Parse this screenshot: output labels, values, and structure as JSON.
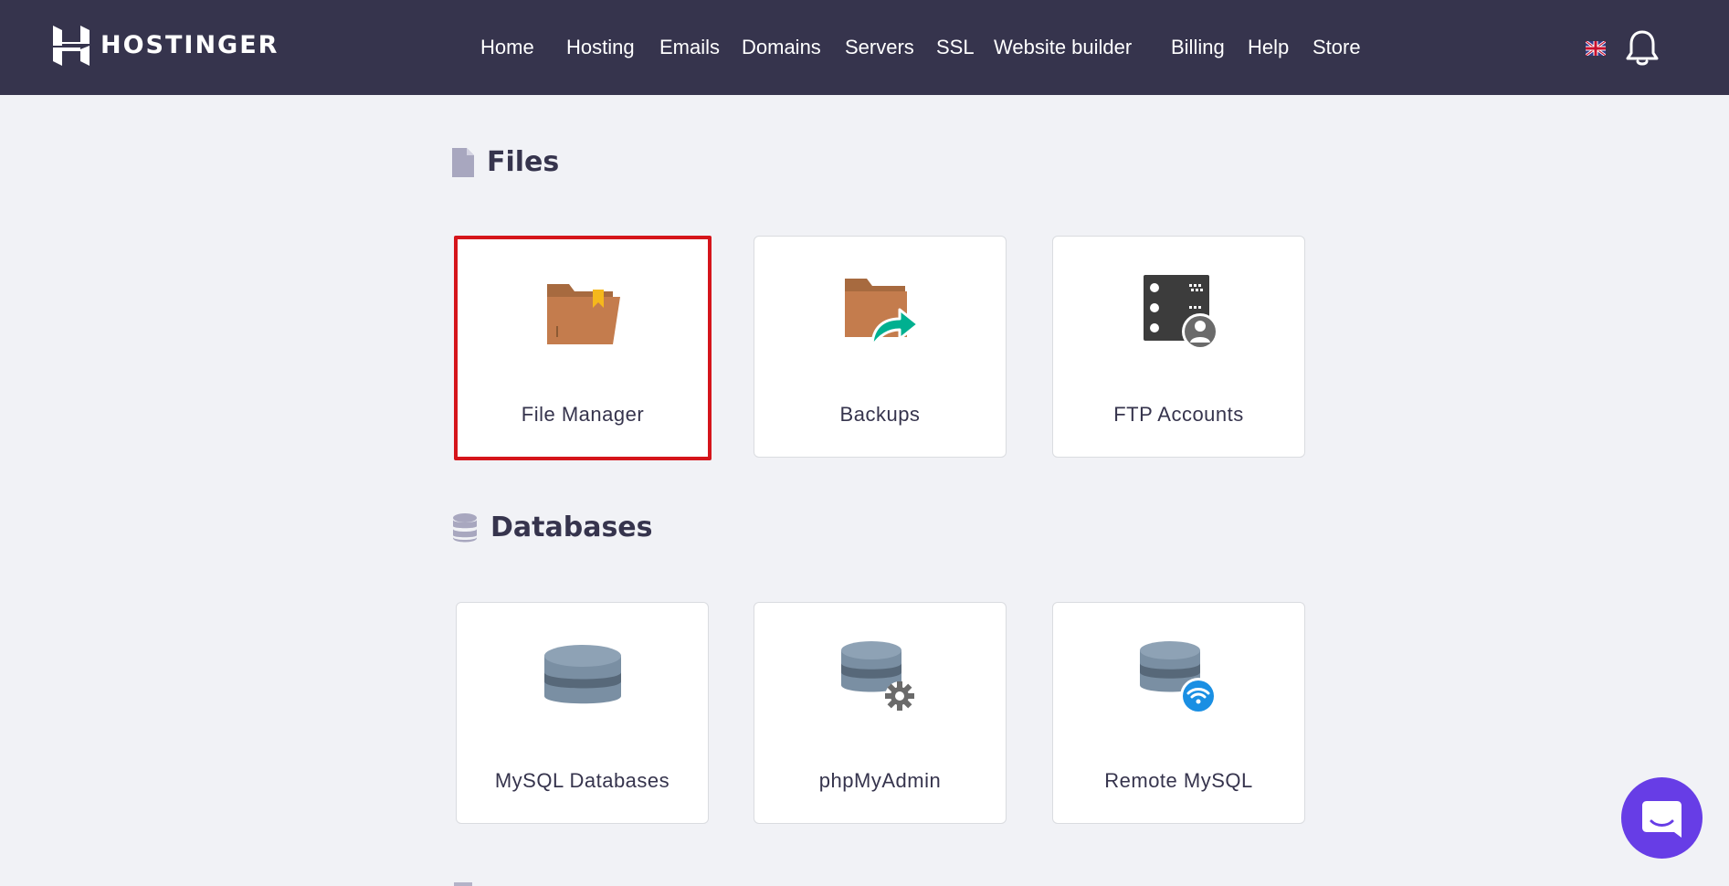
{
  "header": {
    "brand": "HOSTINGER",
    "nav": [
      {
        "label": "Home"
      },
      {
        "label": "Hosting"
      },
      {
        "label": "Emails"
      },
      {
        "label": "Domains"
      },
      {
        "label": "Servers"
      },
      {
        "label": "SSL"
      },
      {
        "label": "Website builder"
      },
      {
        "label": "Billing"
      },
      {
        "label": "Help"
      },
      {
        "label": "Store"
      }
    ],
    "language_icon": "uk-flag-icon",
    "notifications_icon": "bell-icon"
  },
  "sections": {
    "files": {
      "title": "Files",
      "icon": "file-icon",
      "cards": [
        {
          "label": "File Manager",
          "icon": "folder-icon",
          "highlighted": true
        },
        {
          "label": "Backups",
          "icon": "backup-folder-icon"
        },
        {
          "label": "FTP Accounts",
          "icon": "ftp-server-icon"
        }
      ]
    },
    "databases": {
      "title": "Databases",
      "icon": "database-icon",
      "cards": [
        {
          "label": "MySQL Databases",
          "icon": "mysql-database-icon"
        },
        {
          "label": "phpMyAdmin",
          "icon": "phpmyadmin-icon"
        },
        {
          "label": "Remote MySQL",
          "icon": "remote-mysql-icon"
        }
      ]
    }
  },
  "colors": {
    "header_bg": "#36344d",
    "page_bg": "#f1f2f6",
    "highlight_border": "#d5151b",
    "chat_button": "#673de6"
  },
  "chat_icon": "chat-icon"
}
